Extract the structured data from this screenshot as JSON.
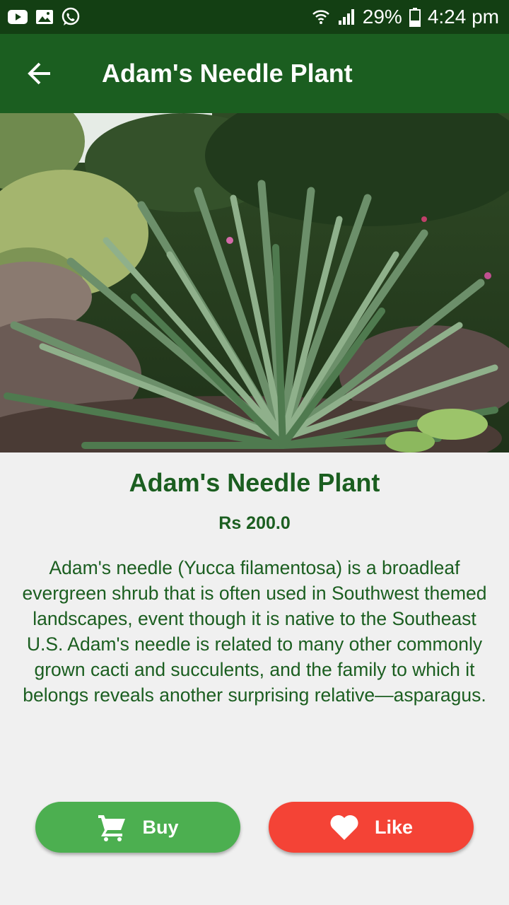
{
  "status_bar": {
    "battery": "29%",
    "time": "4:24 pm",
    "left_icons": [
      "youtube-icon",
      "gallery-icon",
      "whatsapp-icon"
    ],
    "right_icons": [
      "wifi-icon",
      "signal-icon",
      "battery-icon"
    ]
  },
  "appbar": {
    "title": "Adam's Needle Plant",
    "back_icon": "arrow-back-icon",
    "background": "#1b5e20"
  },
  "product": {
    "title": "Adam's Needle Plant",
    "price": "Rs 200.0",
    "description": "Adam's needle (Yucca filamentosa) is a broadleaf evergreen shrub that is often used in Southwest themed landscapes, event though it is native to the Southeast U.S. Adam's needle is related to many other commonly grown cacti and succulents, and the family to which it belongs reveals another surprising relative—asparagus.",
    "text_color": "#1b5e20"
  },
  "buttons": {
    "buy": {
      "label": "Buy",
      "icon": "cart-icon",
      "color": "#4caf50"
    },
    "like": {
      "label": "Like",
      "icon": "heart-icon",
      "color": "#f44336"
    }
  }
}
